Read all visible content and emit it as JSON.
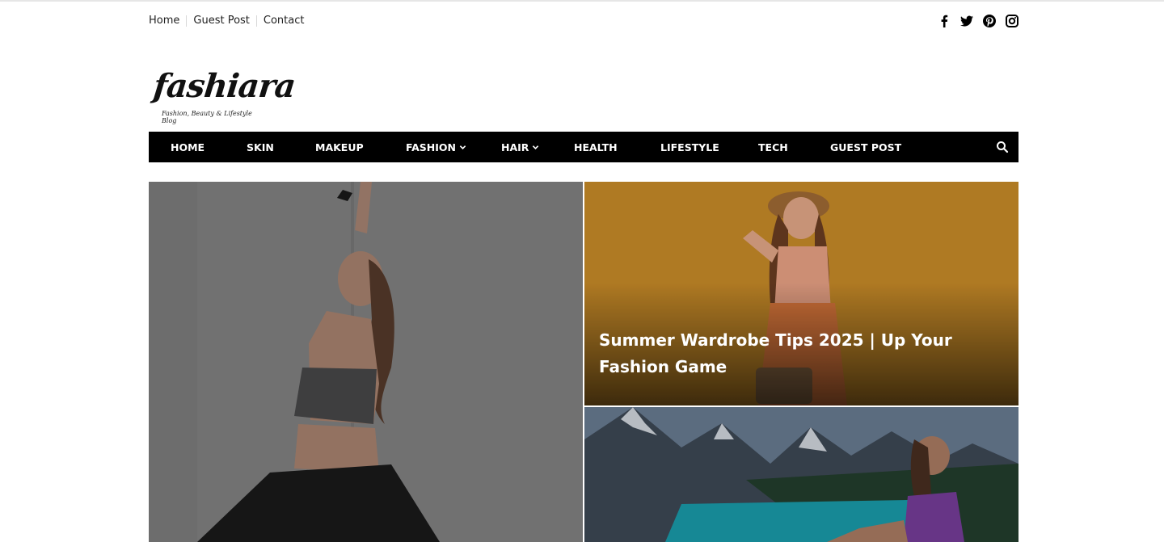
{
  "top_links": [
    "Home",
    "Guest Post",
    "Contact"
  ],
  "social": [
    "facebook-icon",
    "twitter-icon",
    "pinterest-icon",
    "instagram-icon"
  ],
  "logo": {
    "text": "fashiara",
    "tagline": "Fashion, Beauty & Lifestyle Blog"
  },
  "nav": {
    "items": [
      "HOME",
      "SKIN",
      "MAKEUP",
      "FASHION",
      "HAIR",
      "HEALTH",
      "LIFESTYLE",
      "TECH",
      "GUEST POST"
    ],
    "dropdown_items": [
      "FASHION",
      "HAIR"
    ],
    "search_icon": "search-icon"
  },
  "hero": {
    "right_top_title": "Summer Wardrobe Tips 2025 | Up Your Fashion Game"
  },
  "colors": {
    "nav_bg": "#000000",
    "text_white": "#ffffff"
  }
}
